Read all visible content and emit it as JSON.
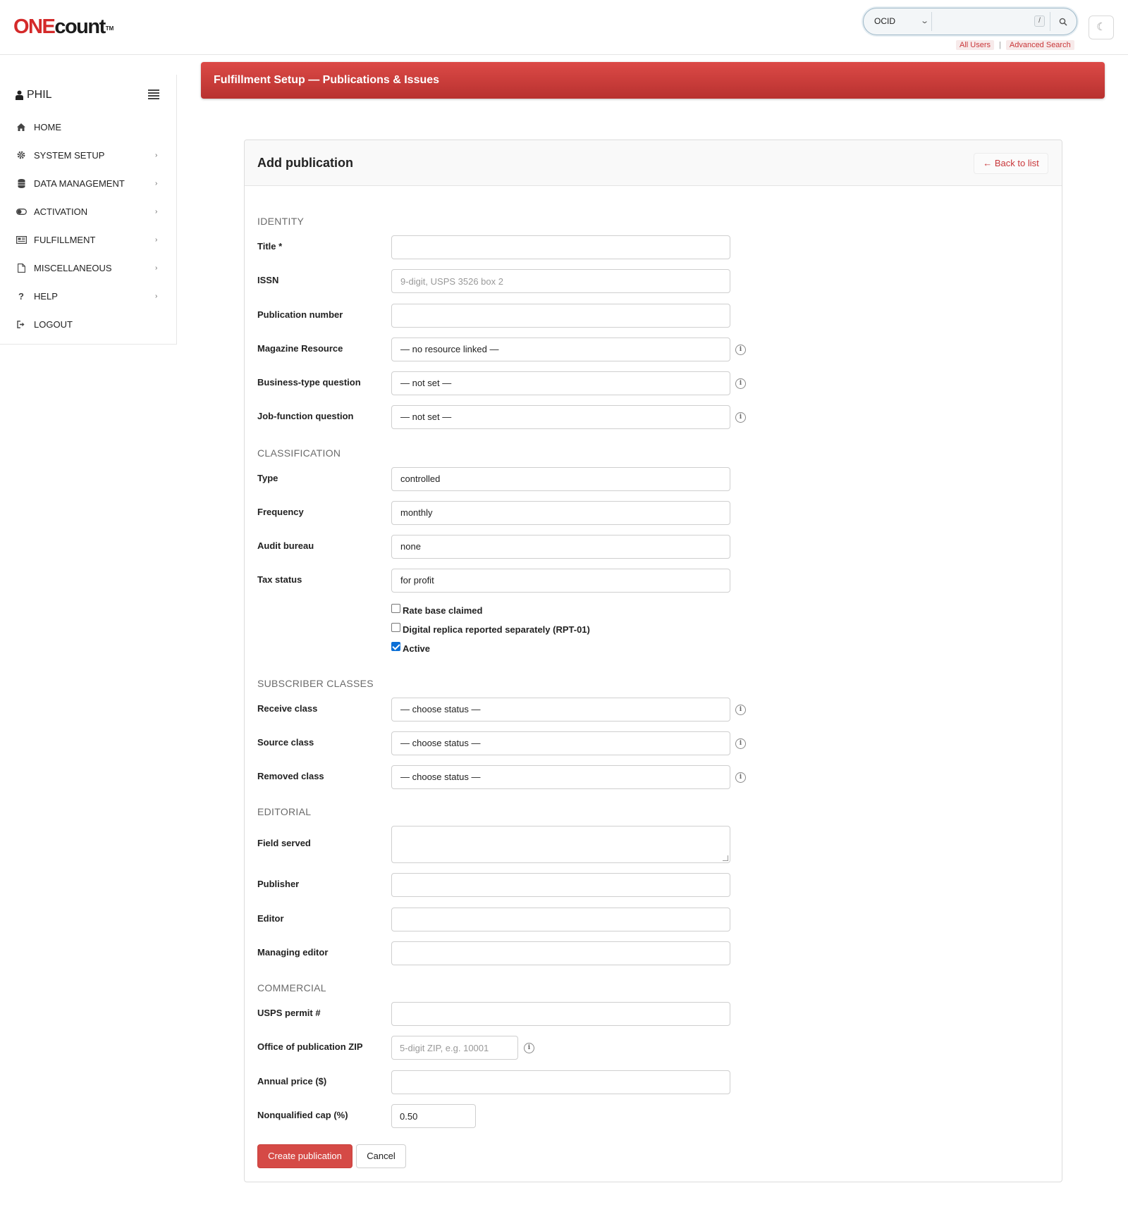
{
  "brand": {
    "logo_one": "ONE",
    "logo_count": "count",
    "logo_tm": "TM",
    "accent": "#d54a46"
  },
  "search": {
    "type_selected": "OCID",
    "input_value": "",
    "shortcut_key": "/",
    "links": {
      "all_users": "All Users",
      "separator": "|",
      "advanced": "Advanced Search"
    }
  },
  "theme_toggle": {
    "glyph": "☾"
  },
  "sidebar": {
    "user": "PHIL",
    "items": [
      {
        "label": "HOME",
        "icon": "home-icon",
        "has_arrow": false
      },
      {
        "label": "SYSTEM SETUP",
        "icon": "gear-icon",
        "has_arrow": true
      },
      {
        "label": "DATA MANAGEMENT",
        "icon": "database-icon",
        "has_arrow": true
      },
      {
        "label": "ACTIVATION",
        "icon": "toggle-icon",
        "has_arrow": true
      },
      {
        "label": "FULFILLMENT",
        "icon": "newspaper-icon",
        "has_arrow": true
      },
      {
        "label": "MISCELLANEOUS",
        "icon": "file-icon",
        "has_arrow": true
      },
      {
        "label": "HELP",
        "icon": "question-icon",
        "has_arrow": true
      },
      {
        "label": "LOGOUT",
        "icon": "sign-out-icon",
        "has_arrow": false
      }
    ],
    "arrow_glyph": "›"
  },
  "banner": {
    "title": "Fulfillment Setup — Publications & Issues"
  },
  "card": {
    "title": "Add publication",
    "back_link": "← Back to list"
  },
  "form": {
    "sections": {
      "identity": "IDENTITY",
      "classification": "CLASSIFICATION",
      "subscriber_classes": "SUBSCRIBER CLASSES",
      "editorial": "EDITORIAL",
      "commercial": "COMMERCIAL"
    },
    "title": {
      "label": "Title *",
      "value": ""
    },
    "issn": {
      "label": "ISSN",
      "value": "",
      "placeholder": "9-digit, USPS 3526 box 2"
    },
    "publication_number": {
      "label": "Publication number",
      "value": ""
    },
    "magazine_resource": {
      "label": "Magazine Resource",
      "value": "— no resource linked —"
    },
    "business_type_question": {
      "label": "Business-type question",
      "value": "— not set —"
    },
    "job_function_question": {
      "label": "Job-function question",
      "value": "— not set —"
    },
    "type": {
      "label": "Type",
      "value": "controlled"
    },
    "frequency": {
      "label": "Frequency",
      "value": "monthly"
    },
    "audit_bureau": {
      "label": "Audit bureau",
      "value": "none"
    },
    "tax_status": {
      "label": "Tax status",
      "value": "for profit"
    },
    "rate_base_claimed": {
      "label": "Rate base claimed",
      "checked": false
    },
    "digital_replica": {
      "label": "Digital replica reported separately (RPT-01)",
      "checked": false
    },
    "active": {
      "label": "Active",
      "checked": true
    },
    "receive_class": {
      "label": "Receive class",
      "value": "— choose status —"
    },
    "source_class": {
      "label": "Source class",
      "value": "— choose status —"
    },
    "removed_class": {
      "label": "Removed class",
      "value": "— choose status —"
    },
    "field_served": {
      "label": "Field served",
      "value": ""
    },
    "publisher": {
      "label": "Publisher",
      "value": ""
    },
    "editor": {
      "label": "Editor",
      "value": ""
    },
    "managing_editor": {
      "label": "Managing editor",
      "value": ""
    },
    "usps_permit": {
      "label": "USPS permit #",
      "value": ""
    },
    "office_zip": {
      "label": "Office of publication ZIP",
      "value": "",
      "placeholder": "5-digit ZIP, e.g. 10001"
    },
    "annual_price": {
      "label": "Annual price ($)",
      "value": ""
    },
    "nonqualified_cap": {
      "label": "Nonqualified cap (%)",
      "value": "0.50"
    },
    "info_glyph": "i"
  },
  "actions": {
    "submit": "Create publication",
    "cancel": "Cancel"
  }
}
